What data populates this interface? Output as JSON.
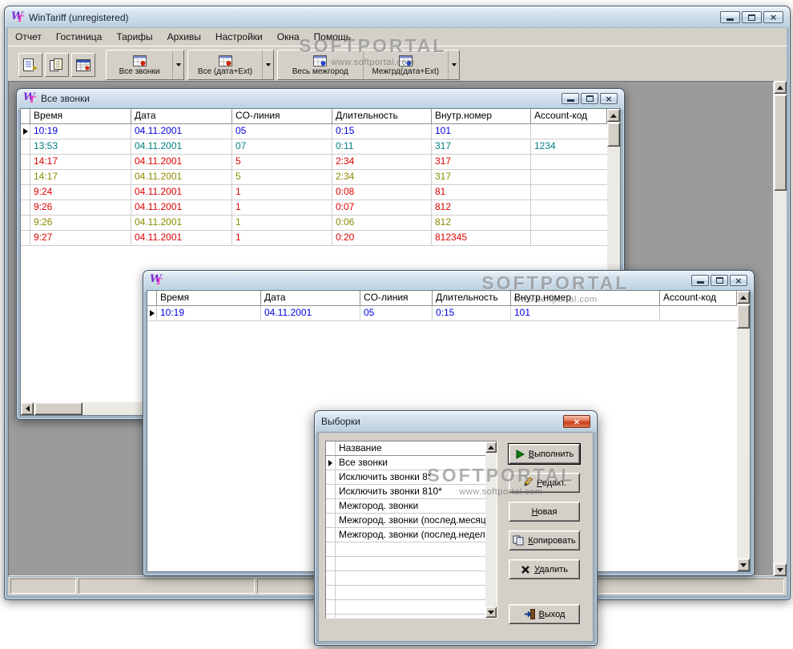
{
  "watermark": {
    "title": "SOFTPORTAL",
    "subtitle": "www.softportal.com"
  },
  "app": {
    "title": "WinTariff (unregistered)",
    "logo": {
      "w": "W",
      "t": "T"
    },
    "menu": [
      "Отчет",
      "Гостиница",
      "Тарифы",
      "Архивы",
      "Настройки",
      "Окна",
      "Помощь"
    ],
    "toolbar": {
      "filter_buttons": [
        {
          "label": "Все звонки"
        },
        {
          "label": "Все (дата+Ext)"
        },
        {
          "label": "Весь межгород"
        },
        {
          "label": "Межгрд(дата+Ext)"
        }
      ]
    },
    "status": {
      "panels": [
        "",
        "",
        ""
      ]
    }
  },
  "icons": {
    "toolbar_small": [
      "report-icon",
      "copy-report-icon",
      "calendar-report-icon"
    ],
    "filter_icon": "calls-table-icon",
    "dropdown_icon": "chevron-down-icon",
    "dialog_icons": {
      "run": "run-icon",
      "edit": "edit-icon",
      "copy": "copy-icon",
      "delete": "delete-x-icon",
      "exit": "exit-icon"
    }
  },
  "colors": {
    "button_face": "#d4d0c8",
    "mdi_background": "#9b9b9b",
    "titlebar_tint": "#bdd0df"
  },
  "grid": {
    "columns": [
      "Время",
      "Дата",
      "CO-линия",
      "Длительность",
      "Внутр.номер",
      "Account-код"
    ]
  },
  "calls_window": {
    "title": "Все звонки",
    "rows": [
      {
        "time": "10:19",
        "date": "04.11.2001",
        "line": "05",
        "dur": "0:15",
        "ext": "101",
        "acc": "",
        "color": "#0000dd"
      },
      {
        "time": "13:53",
        "date": "04.11.2001",
        "line": "07",
        "dur": "0:11",
        "ext": "317",
        "acc": "1234",
        "color": "#008080"
      },
      {
        "time": "14:17",
        "date": "04.11.2001",
        "line": "5",
        "dur": "2:34",
        "ext": "317",
        "acc": "",
        "color": "#dd0000"
      },
      {
        "time": "14:17",
        "date": "04.11.2001",
        "line": "5",
        "dur": "2:34",
        "ext": "317",
        "acc": "",
        "color": "#8b8b00"
      },
      {
        "time": "9:24",
        "date": "04.11.2001",
        "line": "1",
        "dur": "0:08",
        "ext": "81",
        "acc": "",
        "color": "#dd0000"
      },
      {
        "time": "9:26",
        "date": "04.11.2001",
        "line": "1",
        "dur": "0:07",
        "ext": "812",
        "acc": "",
        "color": "#dd0000"
      },
      {
        "time": "9:26",
        "date": "04.11.2001",
        "line": "1",
        "dur": "0:06",
        "ext": "812",
        "acc": "",
        "color": "#8b8b00"
      },
      {
        "time": "9:27",
        "date": "04.11.2001",
        "line": "1",
        "dur": "0:20",
        "ext": "812345",
        "acc": "",
        "color": "#dd0000"
      }
    ]
  },
  "detail_window": {
    "title": "",
    "rows": [
      {
        "time": "10:19",
        "date": "04.11.2001",
        "line": "05",
        "dur": "0:15",
        "ext": "101",
        "acc": "",
        "color": "#0000dd"
      }
    ]
  },
  "dialog": {
    "title": "Выборки",
    "list_header": "Название",
    "items": [
      "Все звонки",
      "Исключить звонки 8*",
      "Исключить звонки 810*",
      "Межгород. звонки",
      "Межгород. звонки (послед.месяц)",
      "Межгород. звонки (послед.неделя)"
    ],
    "buttons": {
      "run": "Выполнить",
      "edit": "Редакт.",
      "new": "Новая",
      "copy": "Копировать",
      "delete": "Удалить",
      "exit": "Выход"
    }
  }
}
